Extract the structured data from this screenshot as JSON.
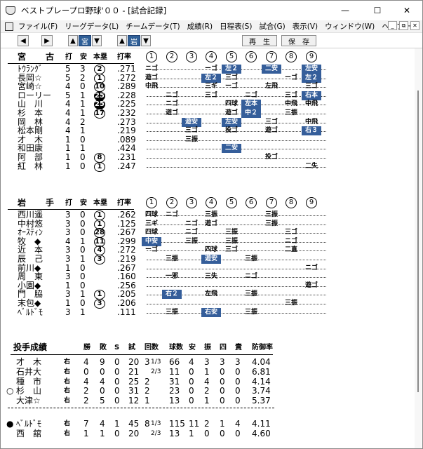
{
  "window": {
    "title": "ベストプレープロ野球'００ - [試合記録]",
    "minimize": "—",
    "maximize": "☐",
    "close": "✕"
  },
  "menu": [
    "ファイル(F)",
    "リーグデータ(L)",
    "チームデータ(T)",
    "成績(R)",
    "日程表(S)",
    "試合(G)",
    "表示(V)",
    "ウィンドウ(W)",
    "ヘルプ(H)"
  ],
  "mdi": [
    "_",
    "⧉",
    "✕"
  ],
  "toolbar": {
    "prev": "◀",
    "next": "▶",
    "team1_arrow_up": "▲",
    "team1": "宮",
    "team1_arrow_down": "▼",
    "team2_arrow_up": "▲",
    "team2": "岩",
    "team2_arrow_down": "▼",
    "replay": "再　生",
    "save": "保　存"
  },
  "innings": [
    "1",
    "2",
    "3",
    "4",
    "5",
    "6",
    "7",
    "8",
    "9"
  ],
  "batting_header": {
    "hits_label": "打",
    "safe_label": "安",
    "hr_label": "本塁",
    "avg_label": "打率"
  },
  "team_a": {
    "name": "宮　古",
    "players": [
      {
        "name": "ﾄｳﾗﾝｸﾞ",
        "ab": "5",
        "h": "3",
        "hr": "2",
        "hr_style": "o",
        "avg": ".271",
        "pa": [
          [
            "ニゴ",
            ""
          ],
          [
            "ーゴ",
            ""
          ],
          [
            "左２",
            "h"
          ],
          [
            "二安",
            "h"
          ],
          [
            "左安",
            "h"
          ]
        ]
      },
      {
        "name": "長岡☆",
        "ab": "5",
        "h": "2",
        "hr": "1",
        "hr_style": "o",
        "avg": ".272",
        "pa": [
          [
            "遊ゴ",
            ""
          ],
          [
            "左２",
            "h"
          ],
          [
            "三ゴ",
            ""
          ],
          [
            "ーゴ",
            ""
          ],
          [
            "左２",
            "h"
          ]
        ]
      },
      {
        "name": "宮崎☆",
        "ab": "4",
        "h": "0",
        "hr": "10",
        "hr_style": "o",
        "avg": ".289",
        "pa": [
          [
            "中飛",
            ""
          ],
          [
            "三ギ",
            ""
          ],
          [
            "ーゴ",
            ""
          ],
          [
            "左飛",
            ""
          ],
          [
            "三ゴ",
            ""
          ]
        ]
      },
      {
        "name": "ローリー",
        "ab": "5",
        "h": "1",
        "hr": "25",
        "hr_style": "f",
        "avg": ".228",
        "pa": [
          [
            "ニゴ",
            ""
          ],
          [
            "三ゴ",
            ""
          ],
          [
            "ニゴ",
            ""
          ],
          [
            "三ゴ",
            ""
          ],
          [
            "右本",
            "h"
          ]
        ]
      },
      {
        "name": "山　川",
        "ab": "4",
        "h": "1",
        "hr": "25",
        "hr_style": "f",
        "avg": ".225",
        "pa": [
          [
            "ニゴ",
            ""
          ],
          [
            "四球",
            ""
          ],
          [
            "左本",
            "h"
          ],
          [
            "中飛",
            ""
          ],
          [
            "中飛",
            ""
          ]
        ]
      },
      {
        "name": "杉　本",
        "ab": "4",
        "h": "1",
        "hr": "17",
        "hr_style": "o",
        "avg": ".232",
        "pa": [
          [
            "遊ゴ",
            ""
          ],
          [
            "遊ゴ",
            ""
          ],
          [
            "中２",
            "h"
          ],
          [
            "三振",
            ""
          ]
        ]
      },
      {
        "name": "岡　林",
        "ab": "4",
        "h": "2",
        "hr": "",
        "hr_style": "",
        "avg": ".273",
        "pa": [
          [
            "遊安",
            "h"
          ],
          [
            "左安",
            "h"
          ],
          [
            "三ゴ",
            ""
          ],
          [
            "中飛",
            ""
          ]
        ]
      },
      {
        "name": "松本剛",
        "ab": "4",
        "h": "1",
        "hr": "",
        "hr_style": "",
        "avg": ".219",
        "pa": [
          [
            "三ゴ",
            ""
          ],
          [
            "投ゴ",
            ""
          ],
          [
            "遊ゴ",
            ""
          ],
          [
            "右３",
            "h"
          ]
        ]
      },
      {
        "name": "才　木",
        "ab": "1",
        "h": "0",
        "hr": "",
        "hr_style": "",
        "avg": ".089",
        "pa": [
          [
            "三振",
            ""
          ]
        ]
      },
      {
        "name": "和田康",
        "ab": "1",
        "h": "1",
        "hr": "",
        "hr_style": "",
        "avg": ".424",
        "pa": [
          [
            "二安",
            "h"
          ]
        ]
      },
      {
        "name": "阿　部",
        "ab": "1",
        "h": "0",
        "hr": "8",
        "hr_style": "o",
        "avg": ".231",
        "pa": [
          [
            "投ゴ",
            ""
          ]
        ]
      },
      {
        "name": "紅　林",
        "ab": "1",
        "h": "0",
        "hr": "1",
        "hr_style": "o",
        "avg": ".247",
        "pa": [
          [
            "二失",
            ""
          ]
        ]
      }
    ]
  },
  "team_b": {
    "name": "岩　手",
    "players": [
      {
        "name": "西川遥",
        "ab": "3",
        "h": "0",
        "hr": "1",
        "hr_style": "o",
        "avg": ".262",
        "pa": [
          [
            "四球",
            ""
          ],
          [
            "ニゴ",
            ""
          ],
          [
            "三振",
            ""
          ],
          [
            "三振",
            ""
          ]
        ]
      },
      {
        "name": "中村悠",
        "ab": "3",
        "h": "0",
        "hr": "1",
        "hr_style": "o",
        "avg": ".125",
        "pa": [
          [
            "三ギ",
            ""
          ],
          [
            "ニゴ",
            ""
          ],
          [
            "遊ゴ",
            ""
          ],
          [
            "三振",
            ""
          ]
        ]
      },
      {
        "name": "ｵｰｽﾃｨﾝ",
        "ab": "3",
        "h": "0",
        "hr": "28",
        "hr_style": "o",
        "avg": ".267",
        "pa": [
          [
            "四球",
            ""
          ],
          [
            "ニゴ",
            ""
          ],
          [
            "三振",
            ""
          ],
          [
            "三ゴ",
            ""
          ]
        ]
      },
      {
        "name": "牧　◆",
        "ab": "4",
        "h": "1",
        "hr": "11",
        "hr_style": "o",
        "avg": ".299",
        "pa": [
          [
            "中安",
            "h"
          ],
          [
            "三振",
            ""
          ],
          [
            "三振",
            ""
          ],
          [
            "ニゴ",
            ""
          ]
        ]
      },
      {
        "name": "近　本",
        "ab": "3",
        "h": "0",
        "hr": "4",
        "hr_style": "o",
        "avg": ".272",
        "pa": [
          [
            "ーゴ",
            ""
          ],
          [
            "四球",
            ""
          ],
          [
            "三ゴ",
            ""
          ],
          [
            "二直",
            ""
          ]
        ]
      },
      {
        "name": "辰　己",
        "ab": "3",
        "h": "1",
        "hr": "3",
        "hr_style": "o",
        "avg": ".219",
        "pa": [
          [
            "三振",
            ""
          ],
          [
            "遊安",
            "h"
          ],
          [
            "三振",
            ""
          ]
        ]
      },
      {
        "name": "前川◆",
        "ab": "1",
        "h": "0",
        "hr": "",
        "hr_style": "",
        "avg": ".267",
        "pa": [
          [
            "ニゴ",
            ""
          ]
        ]
      },
      {
        "name": "周　東",
        "ab": "3",
        "h": "0",
        "hr": "",
        "hr_style": "",
        "avg": ".160",
        "pa": [
          [
            "一邪",
            ""
          ],
          [
            "三失",
            ""
          ],
          [
            "ニゴ",
            ""
          ]
        ]
      },
      {
        "name": "小園◆",
        "ab": "1",
        "h": "0",
        "hr": "",
        "hr_style": "",
        "avg": ".256",
        "pa": [
          [
            "遊ゴ",
            ""
          ]
        ]
      },
      {
        "name": "門　脇",
        "ab": "3",
        "h": "1",
        "hr": "1",
        "hr_style": "o",
        "avg": ".205",
        "pa": [
          [
            "右２",
            "h"
          ],
          [
            "左飛",
            ""
          ],
          [
            "三振",
            ""
          ]
        ]
      },
      {
        "name": "末包◆",
        "ab": "1",
        "h": "0",
        "hr": "3",
        "hr_style": "o",
        "avg": ".206",
        "pa": [
          [
            "三振",
            ""
          ]
        ]
      },
      {
        "name": "ﾍﾞﾙﾄﾞﾓ",
        "ab": "3",
        "h": "1",
        "hr": "",
        "hr_style": "",
        "avg": ".111",
        "pa": [
          [
            "三振",
            ""
          ],
          [
            "右安",
            "h"
          ],
          [
            "三振",
            ""
          ]
        ]
      }
    ]
  },
  "pitching": {
    "title": "投手成績",
    "headers": [
      "勝",
      "敗",
      "S",
      "試",
      "回数",
      "球数",
      "安",
      "振",
      "四",
      "責",
      "防御率"
    ],
    "team_a": [
      {
        "mark": "",
        "name": "才　木",
        "hand": "右",
        "w": "4",
        "l": "9",
        "s": "0",
        "g": "20",
        "ip": "3",
        "ipf": "1/3",
        "np": "66",
        "h": "4",
        "k": "3",
        "bb": "3",
        "er": "3",
        "era": "4.04"
      },
      {
        "mark": "",
        "name": "石井大",
        "hand": "右",
        "w": "0",
        "l": "0",
        "s": "0",
        "g": "21",
        "ip": "",
        "ipf": "2/3",
        "np": "11",
        "h": "0",
        "k": "1",
        "bb": "0",
        "er": "0",
        "era": "6.81"
      },
      {
        "mark": "",
        "name": "種　市",
        "hand": "右",
        "w": "4",
        "l": "4",
        "s": "0",
        "g": "25",
        "ip": "2",
        "ipf": "",
        "np": "31",
        "h": "0",
        "k": "4",
        "bb": "0",
        "er": "0",
        "era": "4.14"
      },
      {
        "mark": "○",
        "name": "杉　山",
        "hand": "右",
        "w": "2",
        "l": "0",
        "s": "0",
        "g": "31",
        "ip": "2",
        "ipf": "",
        "np": "23",
        "h": "0",
        "k": "2",
        "bb": "0",
        "er": "0",
        "era": "3.74"
      },
      {
        "mark": "",
        "name": "大津☆",
        "hand": "右",
        "w": "2",
        "l": "5",
        "s": "0",
        "g": "12",
        "ip": "1",
        "ipf": "",
        "np": "13",
        "h": "0",
        "k": "1",
        "bb": "0",
        "er": "0",
        "era": "5.37"
      }
    ],
    "team_b": [
      {
        "mark": "●",
        "name": "ﾍﾞﾙﾄﾞﾓ",
        "hand": "右",
        "w": "7",
        "l": "4",
        "s": "1",
        "g": "45",
        "ip": "8",
        "ipf": "1/3",
        "np": "115",
        "h": "11",
        "k": "2",
        "bb": "1",
        "er": "4",
        "era": "4.11"
      },
      {
        "mark": "",
        "name": "西　舘",
        "hand": "右",
        "w": "1",
        "l": "1",
        "s": "0",
        "g": "20",
        "ip": "",
        "ipf": "2/3",
        "np": "13",
        "h": "1",
        "k": "0",
        "bb": "0",
        "er": "0",
        "era": "4.60"
      }
    ]
  }
}
